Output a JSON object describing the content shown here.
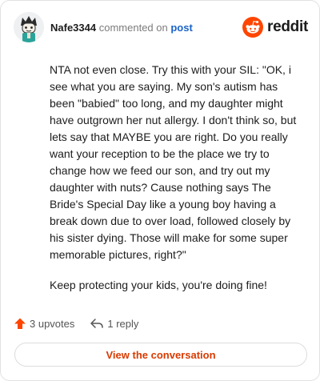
{
  "header": {
    "username": "Nafe3344",
    "verb": "commented on",
    "post_link": "post",
    "brand_name": "reddit",
    "brand_color": "#ff4500"
  },
  "comment": {
    "paragraphs": [
      "NTA not even close. Try this with your SIL: \"OK, i see what you are saying. My son's autism has been \"babied\" too long, and my daughter might have outgrown her nut allergy. I don't think so, but lets say that MAYBE you are right. Do you really want your reception to be the place we try to change how we feed our son, and try out my daughter with nuts? Cause nothing says The Bride's Special Day like a young boy having a break down due to over load, followed closely by his sister dying. Those will make for some super memorable pictures, right?\"",
      "Keep protecting your kids, you're doing fine!"
    ]
  },
  "actions": {
    "upvotes": "3 upvotes",
    "replies": "1 reply",
    "upvote_icon": "upvote-arrow-icon",
    "reply_icon": "reply-arrow-icon"
  },
  "cta": {
    "label": "View the conversation",
    "color": "#d93a00"
  }
}
